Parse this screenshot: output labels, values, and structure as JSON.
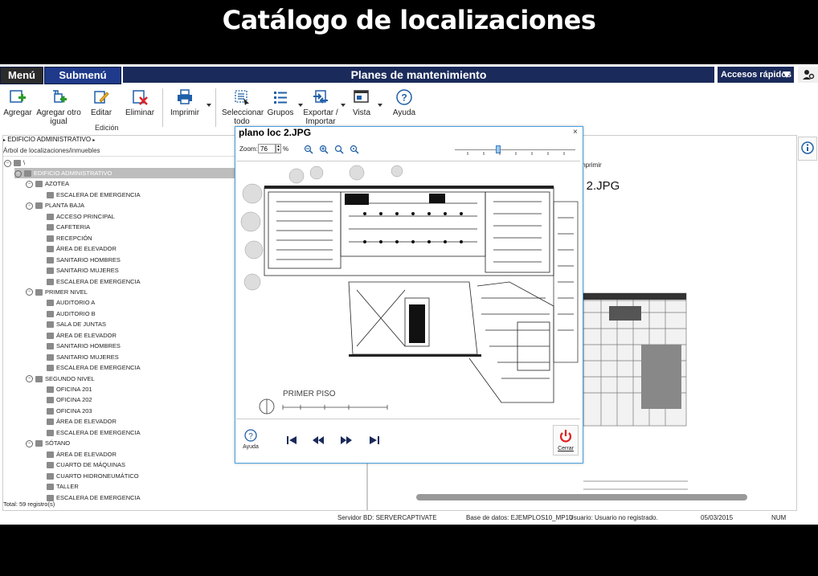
{
  "banner": {
    "title": "Catálogo de localizaciones"
  },
  "topbar": {
    "menu": "Menú",
    "submenu": "Submenú",
    "title": "Planes de mantenimiento",
    "quick_access": "Accesos rápidos"
  },
  "toolbar": {
    "agregar": "Agregar",
    "agregar_otro": "Agregar otro igual",
    "editar": "Editar",
    "eliminar": "Eliminar",
    "edicion_group": "Edición",
    "imprimir": "Imprimir",
    "seleccionar": "Seleccionar todo",
    "grupos": "Grupos",
    "exportar": "Exportar / Importar",
    "vista": "Vista",
    "ayuda": "Ayuda"
  },
  "tree": {
    "breadcrumb": "EDIFICIO ADMINISTRATIVO",
    "header": "Árbol de localizaciones/inmuebles",
    "root": "\\",
    "total": "Total: 59 registro(s)",
    "rows": [
      {
        "label": "EDIFICIO ADMINISTRATIVO",
        "level": 1,
        "expander": true,
        "selected": true
      },
      {
        "label": "AZOTEA",
        "level": 2,
        "expander": true
      },
      {
        "label": "ESCALERA DE EMERGENCIA",
        "level": 3
      },
      {
        "label": "PLANTA BAJA",
        "level": 2,
        "expander": true
      },
      {
        "label": "ACCESO PRINCIPAL",
        "level": 3
      },
      {
        "label": "CAFETERIA",
        "level": 3
      },
      {
        "label": "RECEPCIÓN",
        "level": 3
      },
      {
        "label": "ÁREA DE ELEVADOR",
        "level": 3
      },
      {
        "label": "SANITARIO HOMBRES",
        "level": 3
      },
      {
        "label": "SANITARIO MUJERES",
        "level": 3
      },
      {
        "label": "ESCALERA DE EMERGENCIA",
        "level": 3
      },
      {
        "label": "PRIMER NIVEL",
        "level": 2,
        "expander": true
      },
      {
        "label": "AUDITORIO A",
        "level": 3
      },
      {
        "label": "AUDITORIO B",
        "level": 3
      },
      {
        "label": "SALA DE JUNTAS",
        "level": 3
      },
      {
        "label": "ÁREA DE ELEVADOR",
        "level": 3
      },
      {
        "label": "SANITARIO HOMBRES",
        "level": 3
      },
      {
        "label": "SANITARIO MUJERES",
        "level": 3
      },
      {
        "label": "ESCALERA DE EMERGENCIA",
        "level": 3
      },
      {
        "label": "SEGUNDO NIVEL",
        "level": 2,
        "expander": true
      },
      {
        "label": "OFICINA 201",
        "level": 3
      },
      {
        "label": "OFICINA 202",
        "level": 3
      },
      {
        "label": "OFICINA 203",
        "level": 3
      },
      {
        "label": "ÁREA DE ELEVADOR",
        "level": 3
      },
      {
        "label": "ESCALERA DE EMERGENCIA",
        "level": 3
      },
      {
        "label": "SÓTANO",
        "level": 2,
        "expander": true
      },
      {
        "label": "ÁREA DE ELEVADOR",
        "level": 3
      },
      {
        "label": "CUARTO DE MÁQUINAS",
        "level": 3
      },
      {
        "label": "CUARTO HIDRONEUMÁTICO",
        "level": 3
      },
      {
        "label": "TALLER",
        "level": 3
      },
      {
        "label": "ESCALERA DE EMERGENCIA",
        "level": 3
      }
    ]
  },
  "right_panel": {
    "imprimir_label": "mprimir",
    "filename_partial": "c 2.JPG"
  },
  "dialog": {
    "title": "plano loc 2.JPG",
    "close": "×",
    "zoom_label": "Zoom:",
    "zoom_value": "76",
    "zoom_unit": "%",
    "plan_caption": "PRIMER  PISO",
    "help_label": "Ayuda",
    "close_label": "Cerrar"
  },
  "status": {
    "server": "Servidor BD: SERVERCAPTIVATE",
    "database": "Base de datos: EJEMPLOS10_MP10",
    "user": "Usuario: Usuario no registrado.",
    "date": "05/03/2015",
    "num": "NUM"
  },
  "colors": {
    "nav_dark": "#1a2a5a",
    "submenu": "#1f3a8a",
    "dialog_border": "#4aa0e0",
    "close_red": "#e02020",
    "toolbar_blue": "#1f5fa8"
  }
}
